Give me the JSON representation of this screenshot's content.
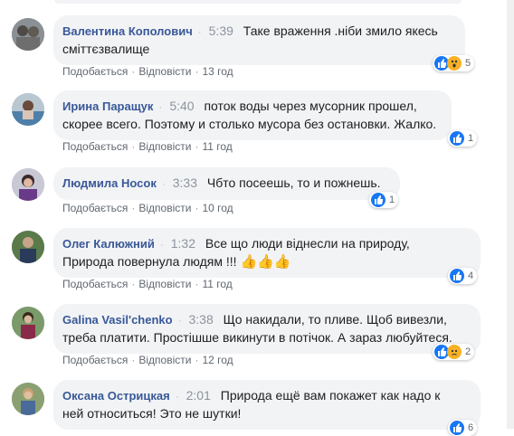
{
  "comments": [
    {
      "author": "Валентина Кополович",
      "time": "5:39",
      "text1": "Таке враження .ніби змило якесь",
      "text2": "сміттєзвалище",
      "like": "Подобається",
      "reply": "Відповісти",
      "ago": "13 год",
      "reactions": "5"
    },
    {
      "author": "Ирина Паращук",
      "time": "5:40",
      "text1": "поток воды через мусорник прошел,",
      "text2": "скорее всего. Поэтому и столько мусора без остановки. Жалко.",
      "like": "Подобається",
      "reply": "Відповісти",
      "ago": "11 год",
      "reactions": "1"
    },
    {
      "author": "Людмила Носок",
      "time": "3:33",
      "text1": "Чбто посеешь, то и пожнешь.",
      "like": "Подобається",
      "reply": "Відповісти",
      "ago": "10 год",
      "reactions": "1"
    },
    {
      "author": "Олег Калюжний",
      "time": "1:32",
      "text1": "Все що люди віднесли на природу,",
      "text2": "Природа повернула людям !!!",
      "like": "Подобається",
      "reply": "Відповісти",
      "ago": "11 год",
      "reactions": "4"
    },
    {
      "author": "Galina Vasil'chenko",
      "time": "3:38",
      "text1": "Що накидали, то пливе. Щоб вивезли,",
      "text2": "треба платити. Простішше викинути в потічок. А зараз любуйтеся.",
      "like": "Подобається",
      "reply": "Відповісти",
      "ago": "12 год",
      "reactions": "2"
    },
    {
      "author": "Оксана Острицкая",
      "time": "2:01",
      "text1": "Природа ещё вам покажет как надо к",
      "text2": "ней относиться! Это не шутки!",
      "reactions": "6"
    }
  ],
  "colors": {
    "like": "#1877f2",
    "author": "#385898",
    "bubble": "#f2f3f5"
  }
}
